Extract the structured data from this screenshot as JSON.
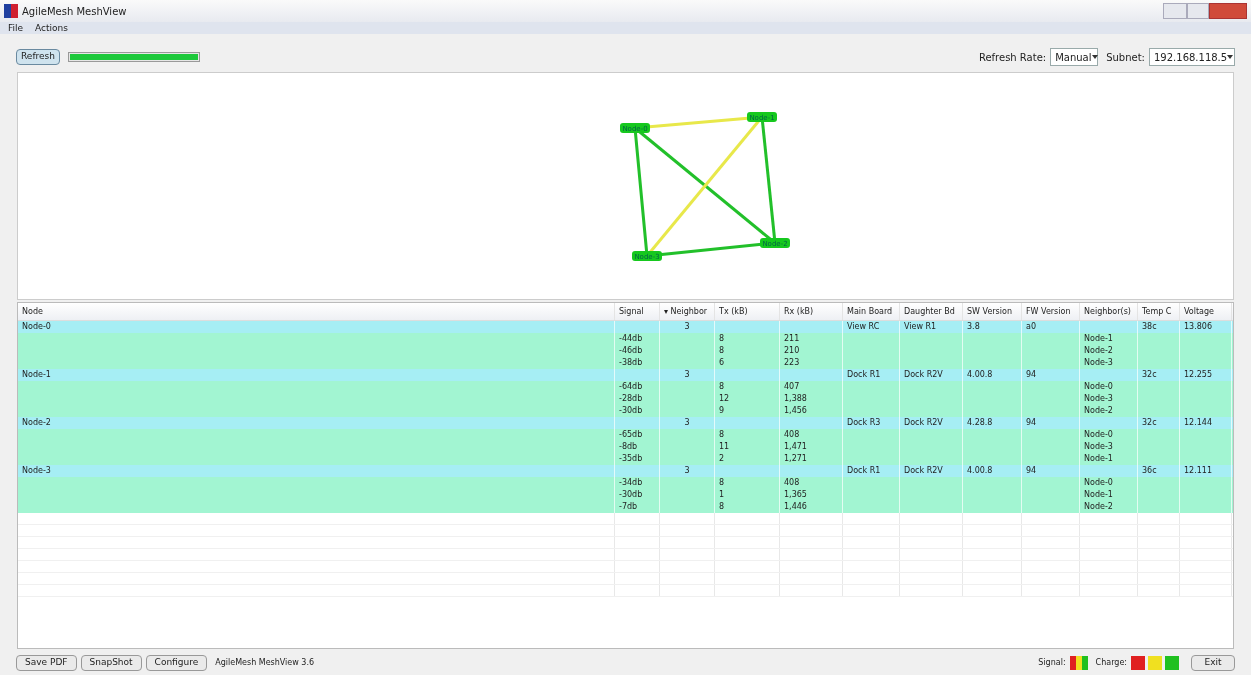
{
  "window": {
    "title": "AgileMesh MeshView"
  },
  "menu": [
    "File",
    "Actions"
  ],
  "toolbar": {
    "refresh": "Refresh",
    "progress": {
      "level": 1
    },
    "refresh_rate_label": "Refresh Rate:",
    "refresh_rate": "Manual",
    "subnet_label": "Subnet:",
    "subnet": "192.168.118.5"
  },
  "graph": {
    "nodes": [
      "Node-0",
      "Node-1",
      "Node-2",
      "Node-3"
    ],
    "edges": [
      {
        "color": "#e8e84a"
      },
      {
        "color": "#22c02a"
      },
      {
        "color": "#22c02a"
      },
      {
        "color": "#22c02a"
      },
      {
        "color": "#e8e84a"
      },
      {
        "color": "#22c02a"
      }
    ]
  },
  "table": {
    "columns": [
      "Node",
      "Signal",
      "▾ Neighbor",
      "Tx (kB)",
      "Rx (kB)",
      "Main Board",
      "Daughter Bd",
      "SW Version",
      "FW Version",
      "Neighbor(s)",
      "Temp C",
      "Voltage"
    ],
    "rows": [
      {
        "kind": "node",
        "cells": [
          "Node-0",
          "",
          "3",
          "",
          "",
          "View RC",
          "View R1",
          "3.8",
          "a0",
          "",
          "38c",
          "13.806"
        ]
      },
      {
        "kind": "link",
        "cells": [
          "",
          "-44db",
          "",
          "8",
          "211",
          "",
          "",
          "",
          "",
          "Node-1",
          "",
          ""
        ]
      },
      {
        "kind": "link",
        "cells": [
          "",
          "-46db",
          "",
          "8",
          "210",
          "",
          "",
          "",
          "",
          "Node-2",
          "",
          ""
        ]
      },
      {
        "kind": "link",
        "cells": [
          "",
          "-38db",
          "",
          "6",
          "223",
          "",
          "",
          "",
          "",
          "Node-3",
          "",
          ""
        ]
      },
      {
        "kind": "node",
        "cells": [
          "Node-1",
          "",
          "3",
          "",
          "",
          "Dock R1",
          "Dock R2V",
          "4.00.8",
          "94",
          "",
          "32c",
          "12.255"
        ]
      },
      {
        "kind": "link",
        "cells": [
          "",
          "-64db",
          "",
          "8",
          "407",
          "",
          "",
          "",
          "",
          "Node-0",
          "",
          ""
        ]
      },
      {
        "kind": "link",
        "cells": [
          "",
          "-28db",
          "",
          "12",
          "1,388",
          "",
          "",
          "",
          "",
          "Node-3",
          "",
          ""
        ]
      },
      {
        "kind": "link",
        "cells": [
          "",
          "-30db",
          "",
          "9",
          "1,456",
          "",
          "",
          "",
          "",
          "Node-2",
          "",
          ""
        ]
      },
      {
        "kind": "node",
        "cells": [
          "Node-2",
          "",
          "3",
          "",
          "",
          "Dock R3",
          "Dock R2V",
          "4.28.8",
          "94",
          "",
          "32c",
          "12.144"
        ]
      },
      {
        "kind": "link",
        "cells": [
          "",
          "-65db",
          "",
          "8",
          "408",
          "",
          "",
          "",
          "",
          "Node-0",
          "",
          ""
        ]
      },
      {
        "kind": "link",
        "cells": [
          "",
          "-8db",
          "",
          "11",
          "1,471",
          "",
          "",
          "",
          "",
          "Node-3",
          "",
          ""
        ]
      },
      {
        "kind": "link",
        "cells": [
          "",
          "-35db",
          "",
          "2",
          "1,271",
          "",
          "",
          "",
          "",
          "Node-1",
          "",
          ""
        ]
      },
      {
        "kind": "node",
        "cells": [
          "Node-3",
          "",
          "3",
          "",
          "",
          "Dock R1",
          "Dock R2V",
          "4.00.8",
          "94",
          "",
          "36c",
          "12.111"
        ]
      },
      {
        "kind": "link",
        "cells": [
          "",
          "-34db",
          "",
          "8",
          "408",
          "",
          "",
          "",
          "",
          "Node-0",
          "",
          ""
        ]
      },
      {
        "kind": "link",
        "cells": [
          "",
          "-30db",
          "",
          "1",
          "1,365",
          "",
          "",
          "",
          "",
          "Node-1",
          "",
          ""
        ]
      },
      {
        "kind": "link",
        "cells": [
          "",
          "-7db",
          "",
          "8",
          "1,446",
          "",
          "",
          "",
          "",
          "Node-2",
          "",
          ""
        ]
      }
    ]
  },
  "footer": {
    "buttons": [
      "Save PDF",
      "SnapShot",
      "Configure"
    ],
    "version": "AgileMesh MeshView 3.6",
    "signal_label": "Signal:",
    "signal_colors": [
      {
        "color": "#e02020"
      },
      {
        "color": "#f0e020"
      },
      {
        "color": "#20c020"
      }
    ],
    "charge_label": "Charge:",
    "charge_colors": [
      {
        "color": "#e02020"
      },
      {
        "color": "#f0e020"
      },
      {
        "color": "#20c020"
      }
    ],
    "exit": "Exit"
  }
}
